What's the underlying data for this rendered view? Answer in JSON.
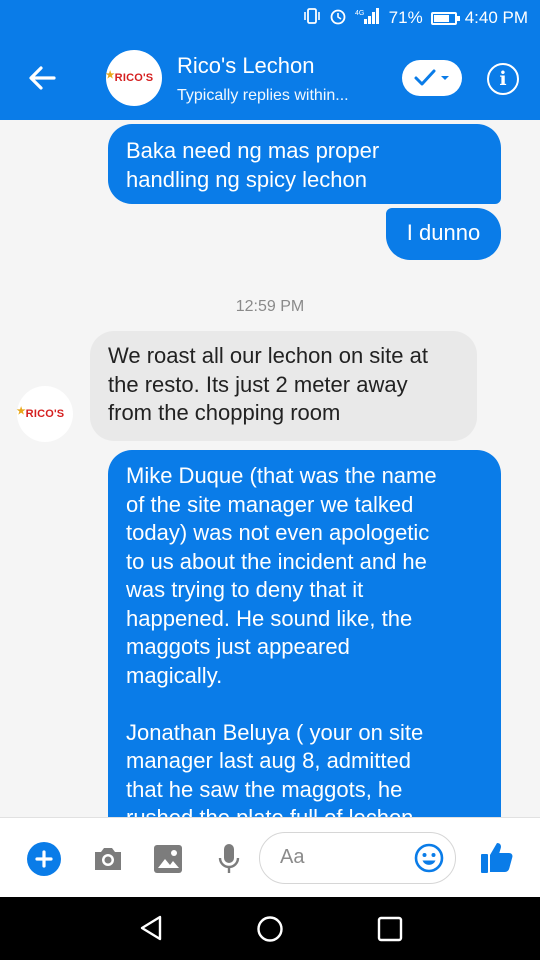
{
  "status_bar": {
    "battery_percent": "71%",
    "battery_level": 0.71,
    "time": "4:40 PM"
  },
  "header": {
    "contact_name": "Rico's Lechon",
    "subtitle": "Typically replies within...",
    "logo_text": "RICO'S"
  },
  "messages": [
    {
      "direction": "outgoing",
      "text": "Baka need ng mas proper\nhandling ng spicy lechon"
    },
    {
      "direction": "outgoing",
      "text": "I dunno"
    },
    {
      "direction": "incoming",
      "text": "We roast all our lechon on site at\nthe resto. Its just 2 meter away\nfrom the chopping room"
    },
    {
      "direction": "outgoing",
      "text": "Mike Duque (that was the name\nof the site manager we talked\ntoday) was not even apologetic\nto us about the incident and he\nwas trying to deny that it\nhappened. He sound like, the\nmaggots just appeared\nmagically.\n\nJonathan Beluya ( your on site\nmanager last aug 8, admitted\nthat he saw the maggots, he\nrushed the plate full of lechon"
    }
  ],
  "timestamp": "12:59 PM",
  "composer": {
    "placeholder": "Aa"
  },
  "colors": {
    "accent": "#0a7ce8",
    "incoming_bubble": "#e9e9e9",
    "logo_red": "#d51f1f",
    "logo_gold": "#e8a81b"
  }
}
